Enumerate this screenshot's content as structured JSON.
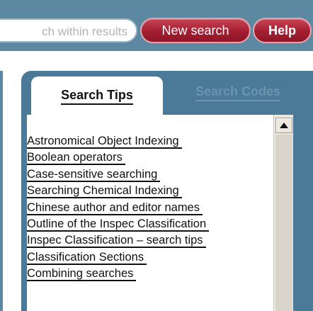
{
  "header": {
    "search_within_placeholder": "ch within results",
    "new_search_label": "New search",
    "help_label": "Help"
  },
  "panel": {
    "tabs": [
      {
        "label": "Search Tips",
        "active": true
      },
      {
        "label": "Search Codes",
        "active": false
      }
    ],
    "items": [
      {
        "label": "Astronomical Object Indexing"
      },
      {
        "label": "Boolean operators"
      },
      {
        "label": "Case-sensitive searching"
      },
      {
        "label": "Searching Chemical Indexing"
      },
      {
        "label": "Chinese author and editor names"
      },
      {
        "label": "Outline of the Inspec Classification"
      },
      {
        "label": "Inspec Classification – search tips"
      },
      {
        "label": "Classification Sections"
      },
      {
        "label": "Combining searches"
      }
    ]
  },
  "scrollbar": {
    "up_icon": "triangle-up-icon"
  },
  "colors": {
    "header_bg": "#5d88a2",
    "panel_bg": "#4a7a97",
    "button_red": "#a31e31",
    "inactive_tab_text": "#6a95ae"
  }
}
